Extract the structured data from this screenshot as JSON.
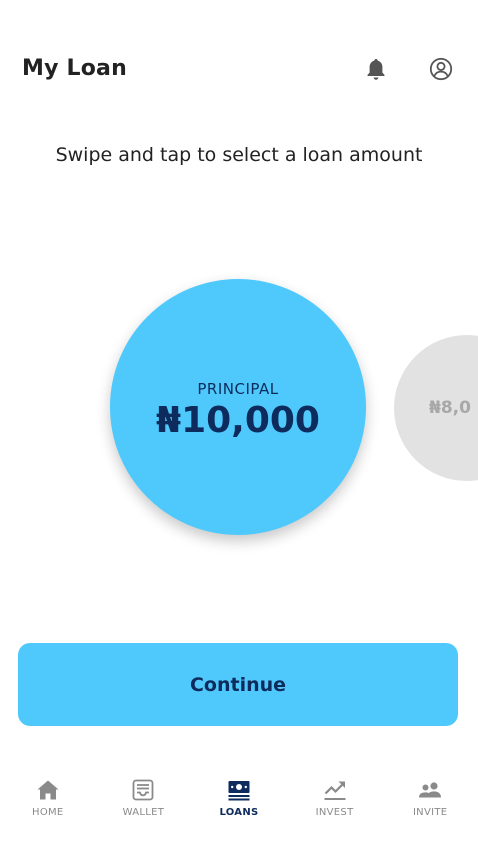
{
  "header": {
    "title": "My Loan",
    "icons": [
      "bell-icon",
      "profile-icon"
    ]
  },
  "instruction": "Swipe and tap to select a loan amount",
  "carousel": {
    "selected": {
      "label": "PRINCIPAL",
      "amount": "₦10,000"
    },
    "next": {
      "amount": "₦8,0"
    }
  },
  "continue_label": "Continue",
  "nav": {
    "items": [
      {
        "label": "HOME",
        "icon": "home-icon",
        "active": false
      },
      {
        "label": "WALLET",
        "icon": "wallet-icon",
        "active": false
      },
      {
        "label": "LOANS",
        "icon": "loans-icon",
        "active": true
      },
      {
        "label": "INVEST",
        "icon": "invest-icon",
        "active": false
      },
      {
        "label": "INVITE",
        "icon": "invite-icon",
        "active": false
      }
    ]
  },
  "colors": {
    "accent": "#4fc9fc",
    "navy": "#0d2b5c",
    "inactive": "#8a8a8a",
    "next_circle": "#e2e2e2"
  }
}
